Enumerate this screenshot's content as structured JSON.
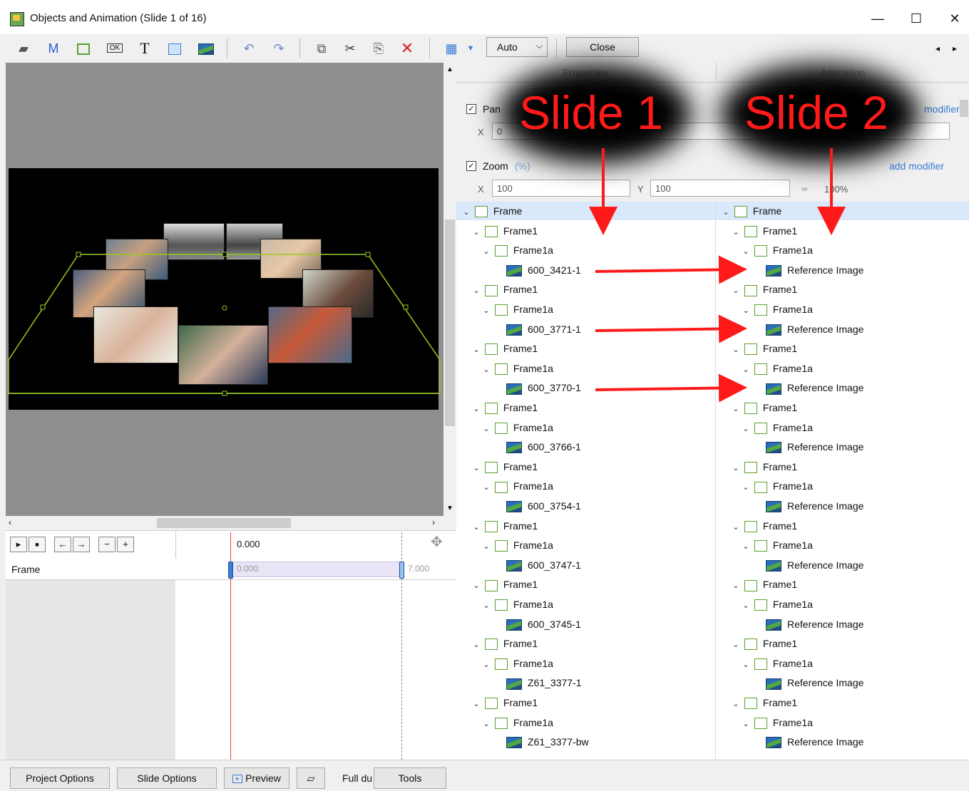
{
  "window": {
    "title": "Objects and Animation (Slide 1 of 16)",
    "minimize": "—",
    "maximize": "☐",
    "close": "✕"
  },
  "toolbar": {
    "auto": "Auto",
    "close": "Close",
    "m_label": "M",
    "t_label": "T"
  },
  "panel": {
    "tab_properties": "Properties",
    "tab_animation": "Animation",
    "pan_label": "Pan",
    "pan_modifier": "modifier",
    "pan_x_label": "X",
    "pan_x_value": "0",
    "zoom_label": "Zoom",
    "zoom_unit": "(%)",
    "zoom_modifier": "add modifier",
    "zoom_x_label": "X",
    "zoom_x_value": "100",
    "zoom_y_label": "Y",
    "zoom_y_value": "100",
    "zoom_link_value": "100%"
  },
  "annotations": {
    "slide1": "Slide 1",
    "slide2": "Slide 2",
    "color": "#ff1a1a"
  },
  "timeline": {
    "time_header": "0.000",
    "row_label": "Frame",
    "start": "0.000",
    "end": "7.000"
  },
  "tree_left": {
    "root": "Frame",
    "groups": [
      {
        "frame1": "Frame1",
        "frame1a": "Frame1a",
        "image": "600_3421-1"
      },
      {
        "frame1": "Frame1",
        "frame1a": "Frame1a",
        "image": "600_3771-1"
      },
      {
        "frame1": "Frame1",
        "frame1a": "Frame1a",
        "image": "600_3770-1"
      },
      {
        "frame1": "Frame1",
        "frame1a": "Frame1a",
        "image": "600_3766-1"
      },
      {
        "frame1": "Frame1",
        "frame1a": "Frame1a",
        "image": "600_3754-1"
      },
      {
        "frame1": "Frame1",
        "frame1a": "Frame1a",
        "image": "600_3747-1"
      },
      {
        "frame1": "Frame1",
        "frame1a": "Frame1a",
        "image": "600_3745-1"
      },
      {
        "frame1": "Frame1",
        "frame1a": "Frame1a",
        "image": "Z61_3377-1"
      },
      {
        "frame1": "Frame1",
        "frame1a": "Frame1a",
        "image": "Z61_3377-bw"
      }
    ]
  },
  "tree_right": {
    "root": "Frame",
    "groups": [
      {
        "frame1": "Frame1",
        "frame1a": "Frame1a",
        "image": "Reference Image"
      },
      {
        "frame1": "Frame1",
        "frame1a": "Frame1a",
        "image": "Reference Image"
      },
      {
        "frame1": "Frame1",
        "frame1a": "Frame1a",
        "image": "Reference Image"
      },
      {
        "frame1": "Frame1",
        "frame1a": "Frame1a",
        "image": "Reference Image"
      },
      {
        "frame1": "Frame1",
        "frame1a": "Frame1a",
        "image": "Reference Image"
      },
      {
        "frame1": "Frame1",
        "frame1a": "Frame1a",
        "image": "Reference Image"
      },
      {
        "frame1": "Frame1",
        "frame1a": "Frame1a",
        "image": "Reference Image"
      },
      {
        "frame1": "Frame1",
        "frame1a": "Frame1a",
        "image": "Reference Image"
      },
      {
        "frame1": "Frame1",
        "frame1a": "Frame1a",
        "image": "Reference Image"
      }
    ]
  },
  "bottom": {
    "project_options": "Project Options",
    "slide_options": "Slide Options",
    "preview": "Preview",
    "full_du": "Full du",
    "tools": "Tools"
  }
}
